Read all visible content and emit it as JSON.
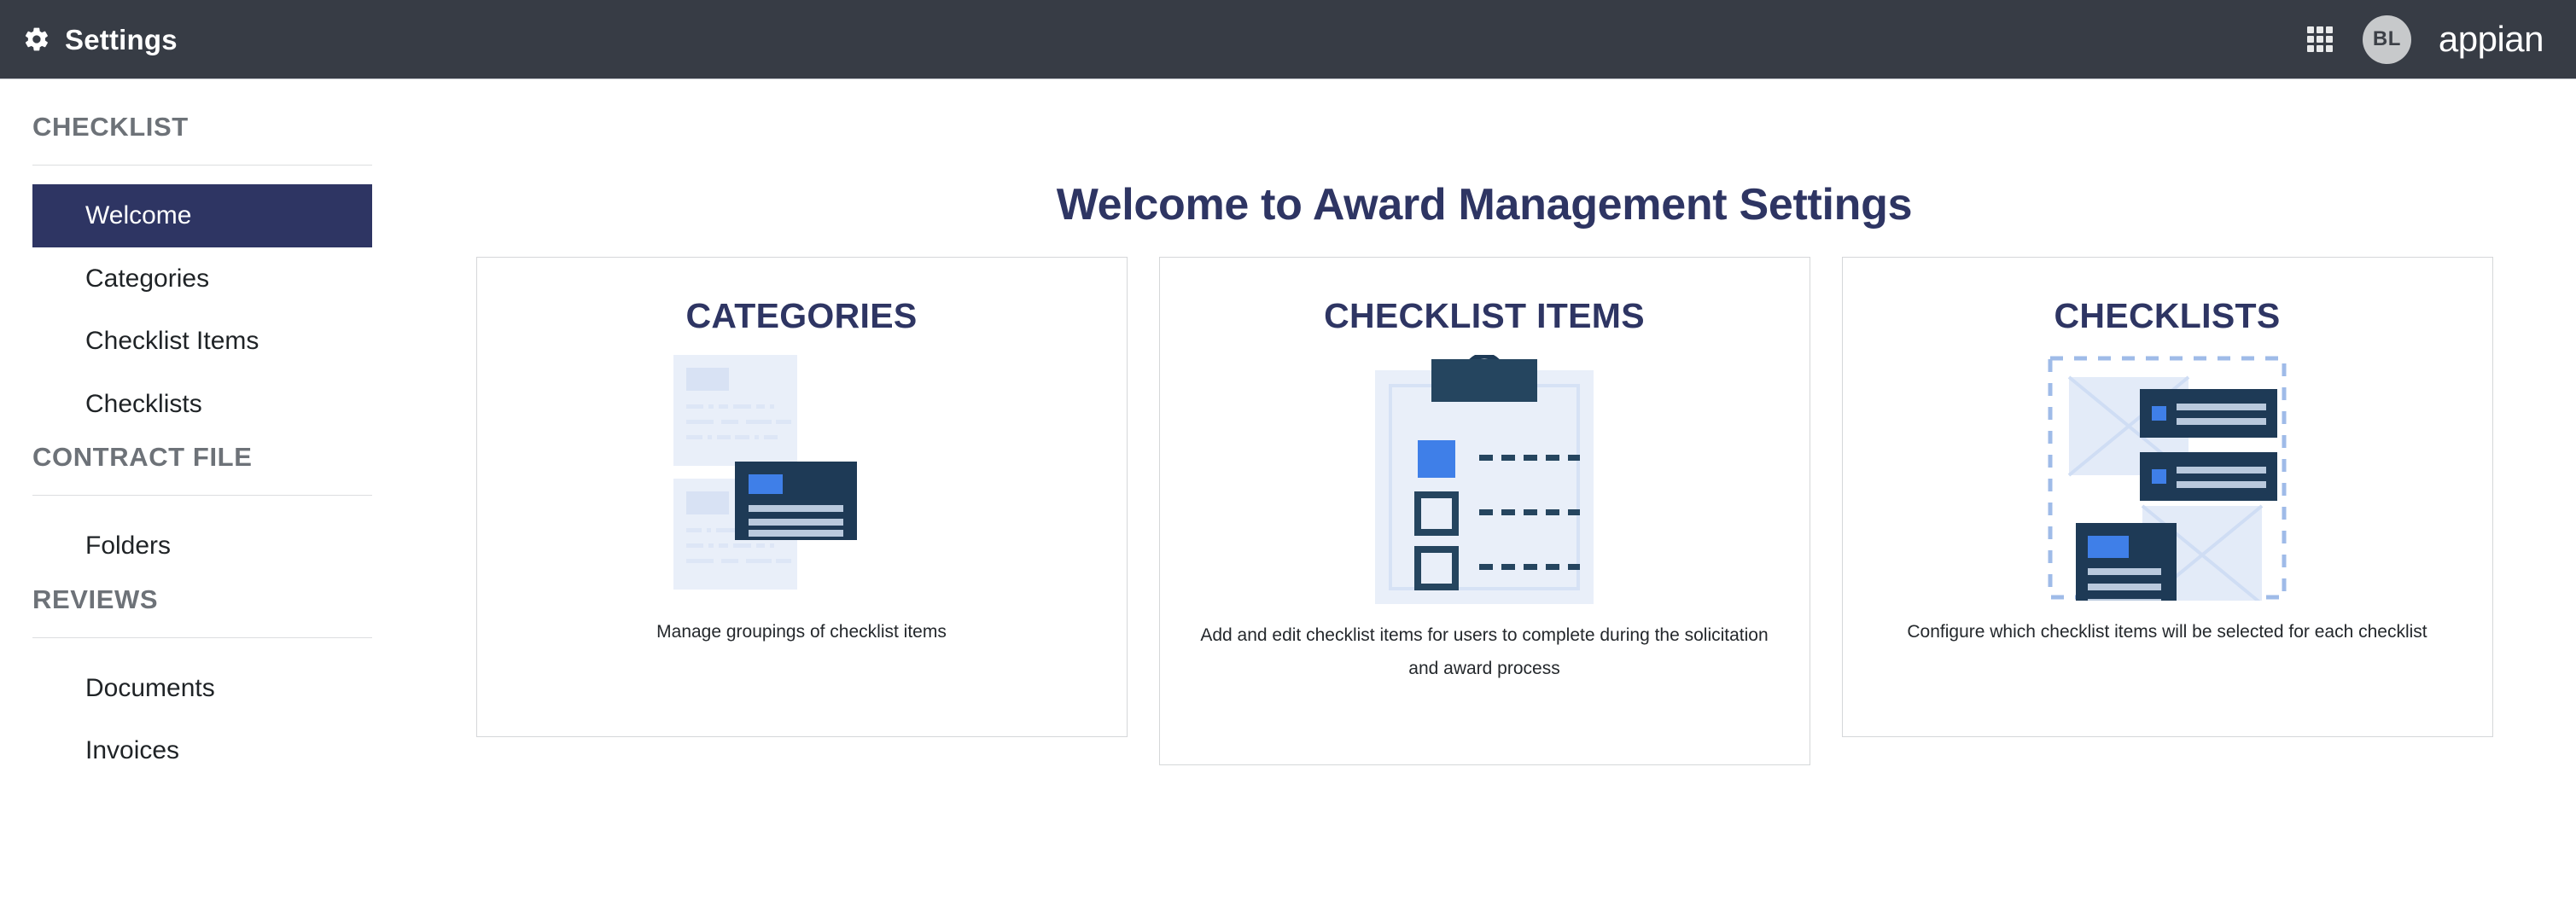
{
  "header": {
    "title": "Settings",
    "gear_icon": "gear-icon",
    "grid_icon": "app-grid-icon",
    "avatar_initials": "BL",
    "logo": "appian"
  },
  "sidebar": {
    "groups": [
      {
        "heading": "CHECKLIST",
        "items": [
          {
            "label": "Welcome",
            "active": true
          },
          {
            "label": "Categories",
            "active": false
          },
          {
            "label": "Checklist Items",
            "active": false
          },
          {
            "label": "Checklists",
            "active": false
          }
        ]
      },
      {
        "heading": "CONTRACT FILE",
        "items": [
          {
            "label": "Folders",
            "active": false
          }
        ]
      },
      {
        "heading": "REVIEWS",
        "items": [
          {
            "label": "Documents",
            "active": false
          },
          {
            "label": "Invoices",
            "active": false
          }
        ]
      }
    ]
  },
  "main": {
    "page_title": "Welcome to Award Management Settings",
    "cards": [
      {
        "title": "CATEGORIES",
        "description": "Manage groupings of checklist items",
        "illustration": "documents-stack-illustration"
      },
      {
        "title": "CHECKLIST ITEMS",
        "description": "Add and edit checklist items for users to complete during the solicitation and award process",
        "illustration": "clipboard-checkboxes-illustration"
      },
      {
        "title": "CHECKLISTS",
        "description": "Configure which checklist items will be selected for each checklist",
        "illustration": "checklist-composition-illustration"
      }
    ]
  },
  "colors": {
    "topbar_bg": "#373c45",
    "accent_navy": "#2e3563",
    "dark_card": "#1e3a56",
    "bright_blue": "#3f7fe8",
    "pale_blue": "#e8eef8",
    "card_border": "#d5d7d9"
  }
}
